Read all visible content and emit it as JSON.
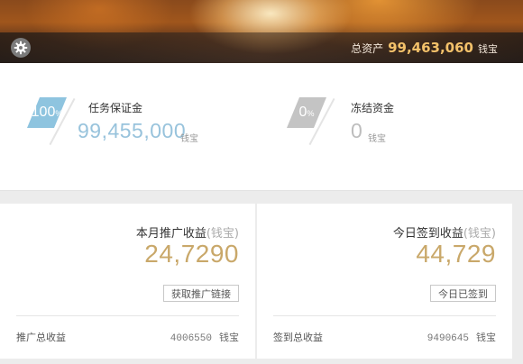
{
  "header": {
    "settings_icon": "gear-icon",
    "total_assets_label": "总资产",
    "total_assets_value": "99,463,060",
    "total_assets_unit": "钱宝"
  },
  "balance": {
    "deposit": {
      "percent": "100",
      "percent_sign": "%",
      "label": "任务保证金",
      "value": "99,455,000",
      "unit": "钱宝",
      "chip_color": "#8ec4df"
    },
    "frozen": {
      "percent": "0",
      "percent_sign": "%",
      "label": "冻结资金",
      "value": "0",
      "unit": "钱宝",
      "chip_color": "#c4c4c4"
    }
  },
  "promotion": {
    "title": "本月推广收益",
    "title_unit": "(钱宝)",
    "amount": "24,7290",
    "button": "获取推广链接",
    "footer_label": "推广总收益",
    "footer_value": "4006550",
    "footer_unit": "钱宝"
  },
  "signin": {
    "title": "今日签到收益",
    "title_unit": "(钱宝)",
    "amount": "44,729",
    "button": "今日已签到",
    "footer_label": "签到总收益",
    "footer_value": "9490645",
    "footer_unit": "钱宝"
  },
  "colors": {
    "accent_gold": "#c9a86a",
    "assets_gold": "#f3c16a",
    "deposit_blue": "#98c3dc"
  }
}
